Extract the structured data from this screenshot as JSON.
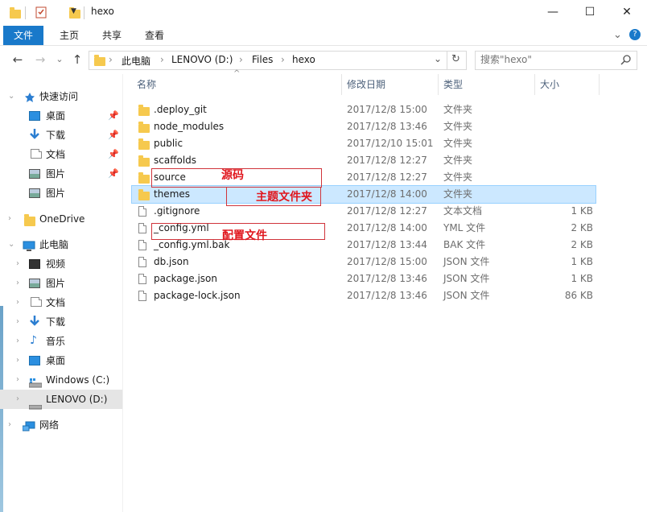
{
  "window": {
    "title": "hexo",
    "minimize": "—",
    "maximize": "☐",
    "close": "✕",
    "help": "?"
  },
  "ribbon": {
    "tabs": [
      "文件",
      "主页",
      "共享",
      "查看"
    ],
    "expand": "⌄"
  },
  "address": {
    "back": "←",
    "forward": "→",
    "recent": "⌄",
    "up": "↑",
    "crumbs": [
      "此电脑",
      "LENOVO (D:)",
      "Files",
      "hexo"
    ],
    "separator": "›",
    "dropdown": "⌄",
    "refresh": "↻",
    "search_placeholder": "搜索\"hexo\"",
    "search_icon": "search-icon"
  },
  "nav": {
    "quick_access": "快速访问",
    "quick_items": [
      "桌面",
      "下载",
      "文档",
      "图片",
      "图片"
    ],
    "onedrive": "OneDrive",
    "this_pc": "此电脑",
    "pc_items": [
      "视频",
      "图片",
      "文档",
      "下载",
      "音乐",
      "桌面",
      "Windows (C:)",
      "LENOVO (D:)"
    ],
    "network": "网络"
  },
  "columns": {
    "name": "名称",
    "date": "修改日期",
    "type": "类型",
    "size": "大小",
    "sort_arrow": "^"
  },
  "files": [
    {
      "name": ".deploy_git",
      "date": "2017/12/8 15:00",
      "type": "文件夹",
      "size": "",
      "kind": "folder"
    },
    {
      "name": "node_modules",
      "date": "2017/12/8 13:46",
      "type": "文件夹",
      "size": "",
      "kind": "folder"
    },
    {
      "name": "public",
      "date": "2017/12/10 15:01",
      "type": "文件夹",
      "size": "",
      "kind": "folder"
    },
    {
      "name": "scaffolds",
      "date": "2017/12/8 12:27",
      "type": "文件夹",
      "size": "",
      "kind": "folder"
    },
    {
      "name": "source",
      "date": "2017/12/8 12:27",
      "type": "文件夹",
      "size": "",
      "kind": "folder"
    },
    {
      "name": "themes",
      "date": "2017/12/8 14:00",
      "type": "文件夹",
      "size": "",
      "kind": "folder"
    },
    {
      "name": ".gitignore",
      "date": "2017/12/8 12:27",
      "type": "文本文档",
      "size": "1 KB",
      "kind": "file"
    },
    {
      "name": "_config.yml",
      "date": "2017/12/8 14:00",
      "type": "YML 文件",
      "size": "2 KB",
      "kind": "file"
    },
    {
      "name": "_config.yml.bak",
      "date": "2017/12/8 13:44",
      "type": "BAK 文件",
      "size": "2 KB",
      "kind": "file"
    },
    {
      "name": "db.json",
      "date": "2017/12/8 15:00",
      "type": "JSON 文件",
      "size": "1 KB",
      "kind": "file"
    },
    {
      "name": "package.json",
      "date": "2017/12/8 13:46",
      "type": "JSON 文件",
      "size": "1 KB",
      "kind": "file"
    },
    {
      "name": "package-lock.json",
      "date": "2017/12/8 13:46",
      "type": "JSON 文件",
      "size": "86 KB",
      "kind": "file"
    }
  ],
  "annotations": {
    "source": "源码",
    "themes": "主题文件夹",
    "config": "配置文件"
  },
  "colors": {
    "accent": "#1979ca",
    "folder": "#f6c94e",
    "selection": "#cce8ff",
    "annotation": "#e0161d"
  }
}
